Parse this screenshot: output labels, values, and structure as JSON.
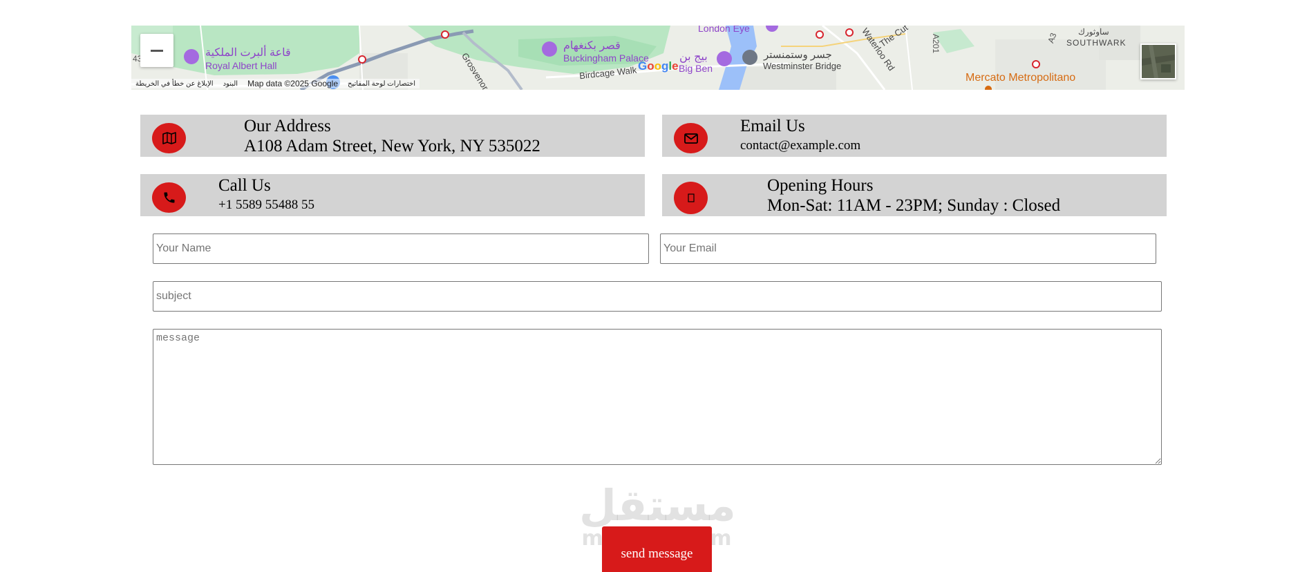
{
  "map": {
    "labels": {
      "royal_albert_hall_ar": "قاعة ألبرت الملكية",
      "royal_albert_hall": "Royal Albert Hall",
      "buckingham_ar": "قصر بكنغهام",
      "buckingham": "Buckingham Palace",
      "birdcage_walk": "Birdcage Walk",
      "big_ben_ar": "بيج بن",
      "big_ben": "Big Ben",
      "westminster_ar": "جسر وستمنستر",
      "westminster": "Westminster Bridge",
      "london_eye": "London Eye",
      "waterloo_rd": "Waterloo Rd",
      "the_cut": "The Cut",
      "a201": "A201",
      "a3": "A3",
      "southwark_ar": "ساوثورك",
      "southwark": "SOUTHWARK",
      "mercato": "Mercato Metropolitano",
      "grosvenor": "Grosvenor",
      "edge_left": "43"
    },
    "google_logo": [
      "G",
      "o",
      "o",
      "g",
      "l",
      "e"
    ],
    "footer": {
      "report_error": "الإبلاغ عن خطأ في الخريطة",
      "terms": "البنود",
      "map_data": "Map data ©2025 Google",
      "shortcuts": "اختصارات لوحة المفاتيح"
    },
    "zoom_out_icon": "minus-icon",
    "colors": {
      "park": "#b9e6c3",
      "water": "#9cc0f9",
      "road": "#8a9ab3",
      "purple_poi": "#a46ae0",
      "orange_poi": "#d66b12"
    }
  },
  "info": {
    "address": {
      "title": "Our Address",
      "value": "A108 Adam Street, New York, NY 535022",
      "icon": "map-icon"
    },
    "email": {
      "title": "Email Us",
      "value": "contact@example.com",
      "icon": "envelope-icon"
    },
    "call": {
      "title": "Call Us",
      "value": "+1 5589 55488 55",
      "icon": "phone-icon"
    },
    "hours": {
      "title": "Opening Hours",
      "value": "Mon-Sat: 11AM - 23PM; Sunday : Closed",
      "icon": "missing-glyph-icon"
    },
    "icon_bg": "#d71a1a",
    "box_bg": "#d3d3d3"
  },
  "form": {
    "name_placeholder": "Your Name",
    "email_placeholder": "Your Email",
    "subject_placeholder": "subject",
    "message_placeholder": "message",
    "send_label": "send message",
    "send_bg": "#d71a1a"
  },
  "watermark": {
    "arabic": "مستقل",
    "latin": "mostaql.com"
  }
}
